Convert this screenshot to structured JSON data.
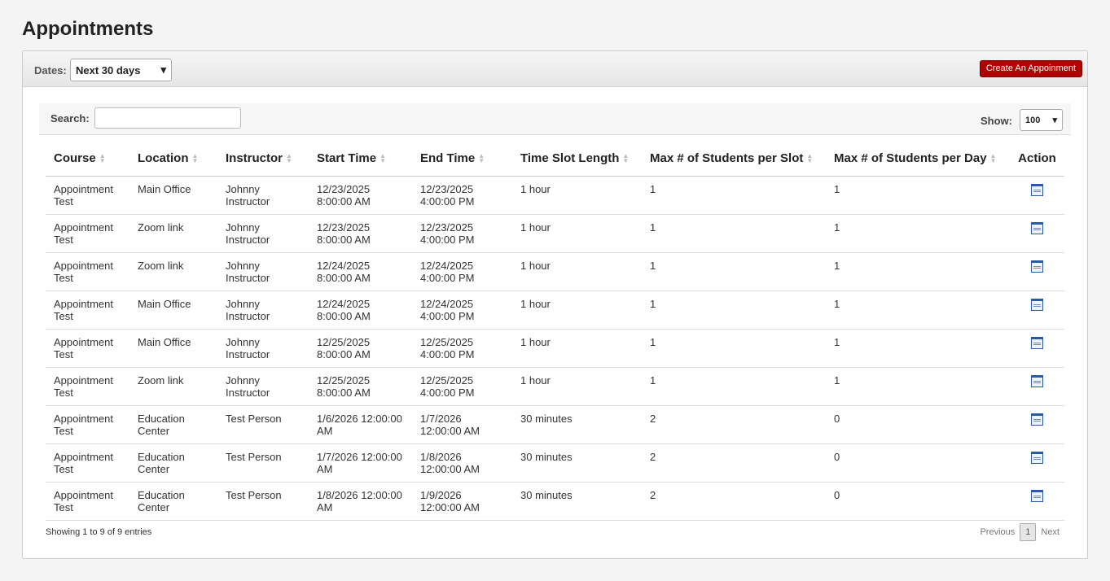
{
  "page": {
    "title": "Appointments"
  },
  "toolbar": {
    "dates_label": "Dates:",
    "dates_value": "Next 30 days",
    "create_button": "Create An Appoinment"
  },
  "table_controls": {
    "search_label": "Search:",
    "search_value": "",
    "show_label": "Show:",
    "show_value": "100"
  },
  "table": {
    "headers": [
      "Course",
      "Location",
      "Instructor",
      "Start Time",
      "End Time",
      "Time Slot Length",
      "Max # of Students per Slot",
      "Max # of Students per Day",
      "Action"
    ],
    "rows": [
      [
        "Appointment Test",
        "Main Office",
        "Johnny Instructor",
        "12/23/2025 8:00:00 AM",
        "12/23/2025 4:00:00 PM",
        "1 hour",
        "1",
        "1"
      ],
      [
        "Appointment Test",
        "Zoom link",
        "Johnny Instructor",
        "12/23/2025 8:00:00 AM",
        "12/23/2025 4:00:00 PM",
        "1 hour",
        "1",
        "1"
      ],
      [
        "Appointment Test",
        "Zoom link",
        "Johnny Instructor",
        "12/24/2025 8:00:00 AM",
        "12/24/2025 4:00:00 PM",
        "1 hour",
        "1",
        "1"
      ],
      [
        "Appointment Test",
        "Main Office",
        "Johnny Instructor",
        "12/24/2025 8:00:00 AM",
        "12/24/2025 4:00:00 PM",
        "1 hour",
        "1",
        "1"
      ],
      [
        "Appointment Test",
        "Main Office",
        "Johnny Instructor",
        "12/25/2025 8:00:00 AM",
        "12/25/2025 4:00:00 PM",
        "1 hour",
        "1",
        "1"
      ],
      [
        "Appointment Test",
        "Zoom link",
        "Johnny Instructor",
        "12/25/2025 8:00:00 AM",
        "12/25/2025 4:00:00 PM",
        "1 hour",
        "1",
        "1"
      ],
      [
        "Appointment Test",
        "Education Center",
        "Test Person",
        "1/6/2026 12:00:00 AM",
        "1/7/2026 12:00:00 AM",
        "30 minutes",
        "2",
        "0"
      ],
      [
        "Appointment Test",
        "Education Center",
        "Test Person",
        "1/7/2026 12:00:00 AM",
        "1/8/2026 12:00:00 AM",
        "30 minutes",
        "2",
        "0"
      ],
      [
        "Appointment Test",
        "Education Center",
        "Test Person",
        "1/8/2026 12:00:00 AM",
        "1/9/2026 12:00:00 AM",
        "30 minutes",
        "2",
        "0"
      ]
    ],
    "action_icon": "edit-icon"
  },
  "footer": {
    "info": "Showing 1 to 9 of 9 entries",
    "previous": "Previous",
    "page": "1",
    "next": "Next"
  }
}
